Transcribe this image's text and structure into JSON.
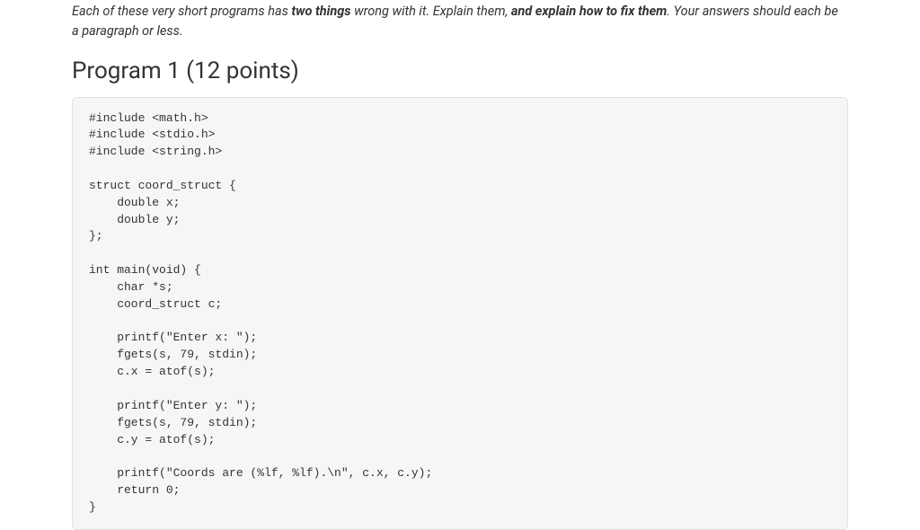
{
  "instructions": {
    "part1": "Each of these very short programs has ",
    "bold1": "two things",
    "part2": " wrong with it.  Explain them, ",
    "bold2": "and explain how to fix them",
    "part3": ".  Your answers should each be a paragraph or less."
  },
  "heading": "Program 1 (12 points)",
  "code": "#include <math.h>\n#include <stdio.h>\n#include <string.h>\n\nstruct coord_struct {\n    double x;\n    double y;\n};\n\nint main(void) {\n    char *s;\n    coord_struct c;\n\n    printf(\"Enter x: \");\n    fgets(s, 79, stdin);\n    c.x = atof(s);\n\n    printf(\"Enter y: \");\n    fgets(s, 79, stdin);\n    c.y = atof(s);\n\n    printf(\"Coords are (%lf, %lf).\\n\", c.x, c.y);\n    return 0;\n}"
}
